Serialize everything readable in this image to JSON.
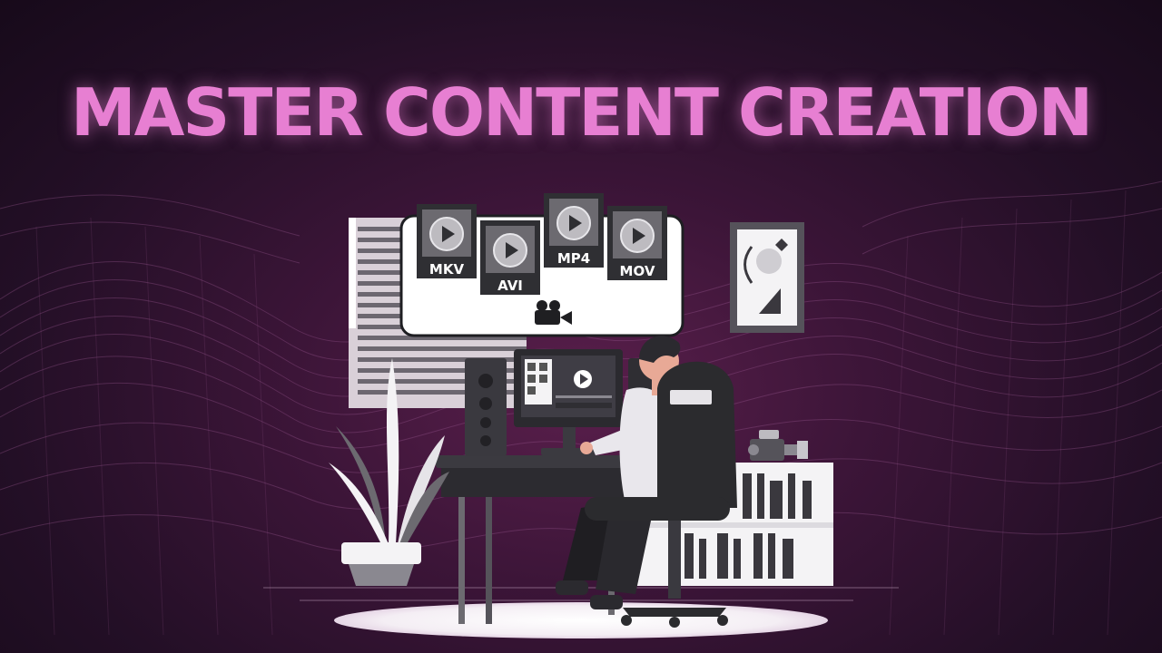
{
  "title": "MASTER CONTENT CREATION",
  "file_badges": [
    {
      "label": "MKV"
    },
    {
      "label": "AVI"
    },
    {
      "label": "MP4"
    },
    {
      "label": "MOV"
    }
  ],
  "colors": {
    "title_pink": "#e77fd2",
    "background_dark": "#1a0c1f",
    "background_magenta": "#5a1f4c",
    "badge_dark": "#2f2f33",
    "chair_dark": "#2b2b2e"
  },
  "icons": [
    "play-icon",
    "movie-camera-icon"
  ]
}
